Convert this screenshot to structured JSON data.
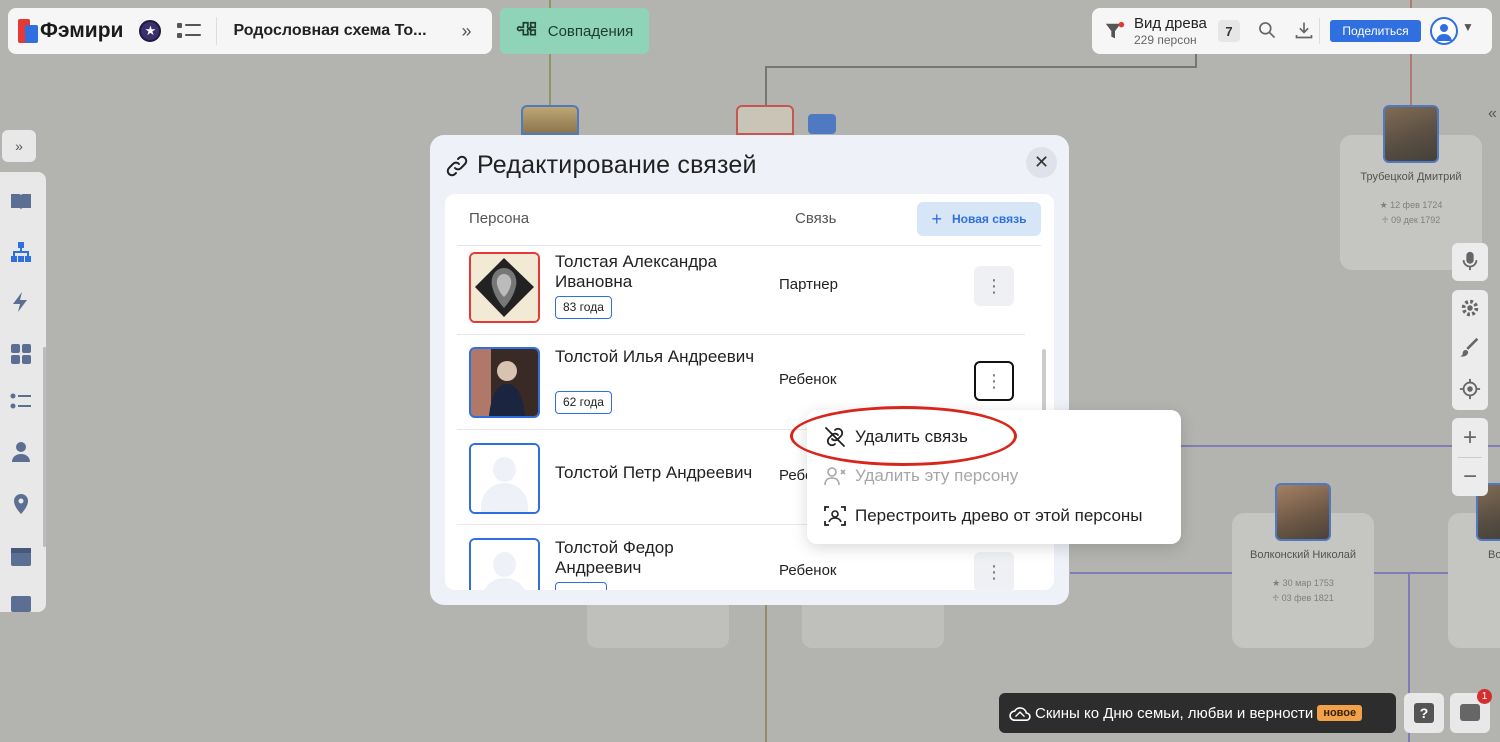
{
  "app": {
    "logo_text": "Фэмири",
    "tree_title": "Родословная схема То...",
    "matches_label": "Совпадения"
  },
  "view": {
    "title": "Вид древа",
    "subtitle": "229 персон",
    "filter_count": "7",
    "share_label": "Поделиться"
  },
  "background_cards": [
    {
      "name": "Трубецкой Дмитрий",
      "born": "12 фев 1724",
      "died": "09 дек 1792"
    },
    {
      "name": "Волконский Николай",
      "born": "30 мар 1753",
      "died": "03 фев 1821"
    },
    {
      "name": "Во Ек",
      "born": "",
      "died": ""
    }
  ],
  "modal": {
    "title": "Редактирование связей",
    "col_person": "Персона",
    "col_relation": "Связь",
    "new_link_label": "Новая связь",
    "rows": [
      {
        "name": "Толстая Александра Ивановна",
        "age": "83 года",
        "relation": "Партнер"
      },
      {
        "name": "Толстой Илья Андреевич",
        "age": "62 года",
        "relation": "Ребенок"
      },
      {
        "name": "Толстой Петр Андреевич",
        "age": "",
        "relation": "Ребенок"
      },
      {
        "name": "Толстой Федор Андреевич",
        "age": "",
        "relation": "Ребенок"
      }
    ]
  },
  "context_menu": {
    "items": [
      {
        "label": "Удалить связь",
        "enabled": true
      },
      {
        "label": "Удалить эту персону",
        "enabled": false
      },
      {
        "label": "Перестроить древо от этой персоны",
        "enabled": true
      }
    ]
  },
  "banner": {
    "text": "Скины ко Дню семьи, любви и верности",
    "badge": "новое"
  },
  "chat": {
    "notifications": "1"
  },
  "colors": {
    "accent": "#2f6fe0",
    "danger": "#e53935",
    "matches_bg": "#8fd3b8",
    "highlight_ring": "#d9261c"
  }
}
